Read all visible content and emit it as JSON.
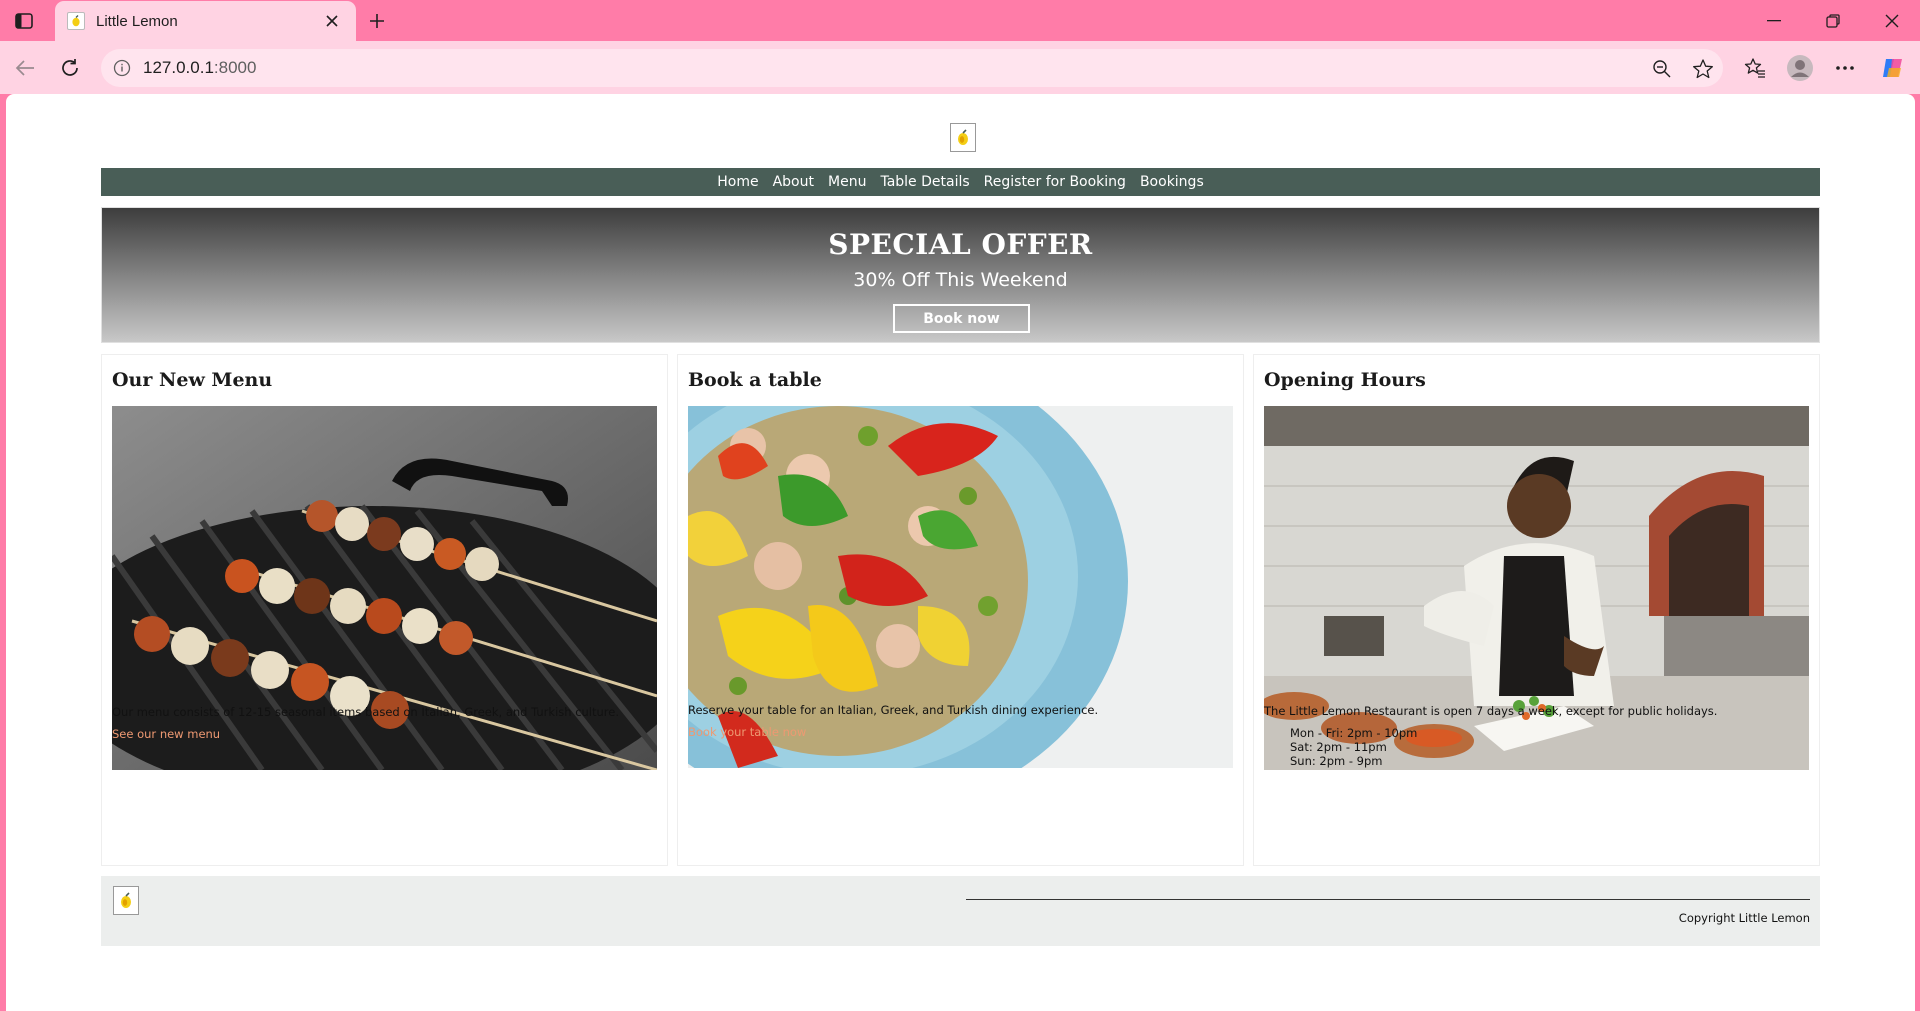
{
  "browser": {
    "tab_title": "Little Lemon",
    "url_host": "127.0.0.1",
    "url_port": ":8000",
    "colors": {
      "frame": "#ff7ca8",
      "toolbar": "#ffd3e3"
    },
    "icons": [
      "sidebar-toggle-icon",
      "favicon-icon",
      "close-icon",
      "plus-icon",
      "minimize-icon",
      "restore-icon",
      "back-icon",
      "reload-icon",
      "info-icon",
      "zoom-out-icon",
      "star-icon",
      "favorites-icon",
      "profile-icon",
      "more-icon",
      "copilot-icon"
    ]
  },
  "site": {
    "nav": [
      "Home",
      "About",
      "Menu",
      "Table Details",
      "Register for Booking",
      "Bookings"
    ],
    "hero": {
      "title": "SPECIAL OFFER",
      "subtitle": "30% Off This Weekend",
      "button": "Book now"
    },
    "cards": [
      {
        "title": "Our New Menu",
        "text": "Our menu consists of 12-15 seasonal items based on Italian, Greek, and Turkish culture.",
        "link": "See our new menu"
      },
      {
        "title": "Book a table",
        "text": "Reserve your table for an Italian, Greek, and Turkish dining experience.",
        "link": "Book your table now"
      },
      {
        "title": "Opening Hours",
        "text": "The Little Lemon Restaurant is open 7 days a week, except for public holidays.",
        "hours": [
          "Mon - Fri: 2pm - 10pm",
          "Sat: 2pm - 11pm",
          "Sun: 2pm - 9pm"
        ]
      }
    ],
    "footer": {
      "copyright": "Copyright Little Lemon"
    },
    "colors": {
      "nav": "#495e57",
      "link": "#ee9972",
      "footer": "#eceeed"
    }
  }
}
